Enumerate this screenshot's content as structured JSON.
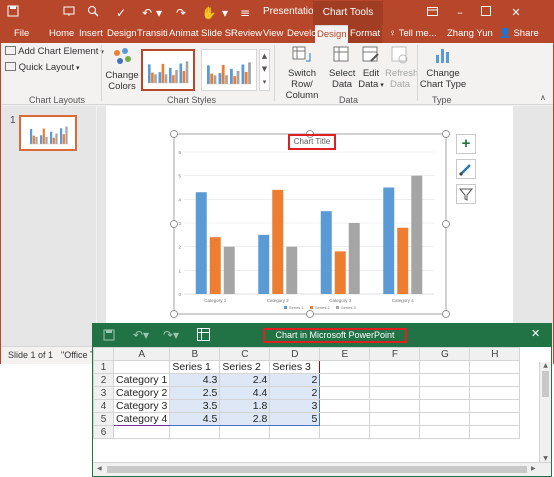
{
  "ppt": {
    "title": "Presentatio...",
    "context_title": "Chart Tools",
    "tabs": [
      "File",
      "Home",
      "Insert",
      "Design",
      "Transiti",
      "Animat",
      "Slide Sl",
      "Review",
      "View",
      "Develo",
      "Design",
      "Format"
    ],
    "tell_me": "Tell me...",
    "user": "Zhang Yun",
    "share": "Share",
    "ribbon": {
      "add_chart_element": "Add Chart Element",
      "quick_layout": "Quick Layout",
      "change_colors_1": "Change",
      "change_colors_2": "Colors",
      "switch_1": "Switch Row/",
      "switch_2": "Column",
      "select_1": "Select",
      "select_2": "Data",
      "edit_1": "Edit",
      "edit_2": "Data",
      "refresh_1": "Refresh",
      "refresh_2": "Data",
      "change_type_1": "Change",
      "change_type_2": "Chart Type",
      "groups": {
        "chart_layouts": "Chart Layouts",
        "chart_styles": "Chart Styles",
        "data": "Data",
        "type": "Type"
      }
    },
    "slide_number": "1",
    "status_left": "Slide 1 of 1",
    "status_right": "\"Office Th"
  },
  "chart_data": {
    "type": "bar",
    "title": "Chart Title",
    "categories": [
      "Category 1",
      "Category 2",
      "Category 3",
      "Category 4"
    ],
    "series": [
      {
        "name": "Series 1",
        "values": [
          4.3,
          2.5,
          3.5,
          4.5
        ]
      },
      {
        "name": "Series 2",
        "values": [
          2.4,
          4.4,
          1.8,
          2.8
        ]
      },
      {
        "name": "Series 3",
        "values": [
          2,
          2,
          3,
          5
        ]
      }
    ],
    "ylim": [
      0,
      6
    ],
    "yticks": [
      "0",
      "1",
      "2",
      "3",
      "4",
      "5",
      "6"
    ],
    "colors": [
      "#5b9bd5",
      "#ed7d31",
      "#a5a5a5"
    ],
    "grid": true,
    "legend": "bottom"
  },
  "excel": {
    "title": "Chart in Microsoft PowerPoint",
    "columns": [
      "A",
      "B",
      "C",
      "D",
      "E",
      "F",
      "G",
      "H"
    ],
    "rows": [
      {
        "n": "1",
        "cells": [
          "",
          "Series 1",
          "Series 2",
          "Series 3"
        ]
      },
      {
        "n": "2",
        "cells": [
          "Category 1",
          "4.3",
          "2.4",
          "2"
        ]
      },
      {
        "n": "3",
        "cells": [
          "Category 2",
          "2.5",
          "4.4",
          "2"
        ]
      },
      {
        "n": "4",
        "cells": [
          "Category 3",
          "3.5",
          "1.8",
          "3"
        ]
      },
      {
        "n": "5",
        "cells": [
          "Category 4",
          "4.5",
          "2.8",
          "5"
        ]
      },
      {
        "n": "6",
        "cells": [
          "",
          "",
          "",
          ""
        ]
      }
    ]
  }
}
